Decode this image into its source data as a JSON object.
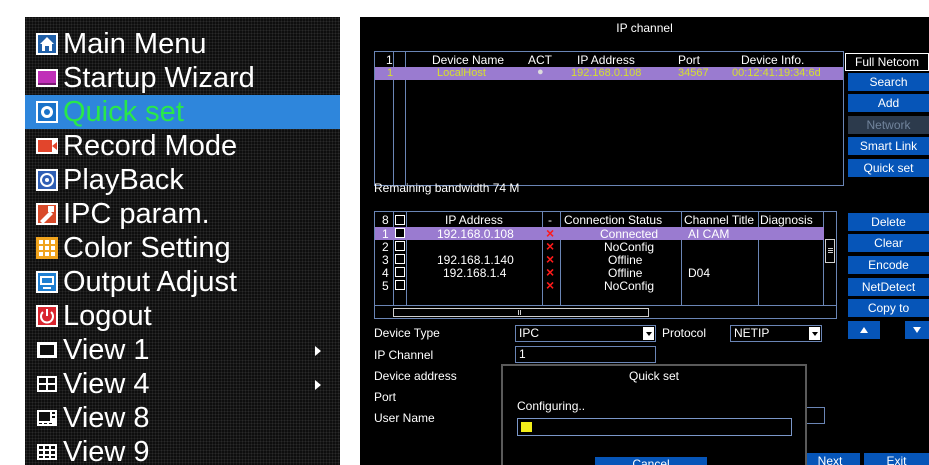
{
  "menu": {
    "items": [
      {
        "label": "Main Menu",
        "icon": "home-icon"
      },
      {
        "label": "Startup Wizard",
        "icon": "wizard-icon"
      },
      {
        "label": "Quick set",
        "icon": "quick-set-icon",
        "selected": true
      },
      {
        "label": "Record Mode",
        "icon": "record-icon"
      },
      {
        "label": "PlayBack",
        "icon": "playback-icon"
      },
      {
        "label": "IPC param.",
        "icon": "ipc-param-icon"
      },
      {
        "label": "Color Setting",
        "icon": "color-setting-icon"
      },
      {
        "label": "Output Adjust",
        "icon": "output-adjust-icon"
      },
      {
        "label": "Logout",
        "icon": "power-icon"
      },
      {
        "label": "View 1",
        "icon": "view-1-icon",
        "submenu": true
      },
      {
        "label": "View 4",
        "icon": "view-4-icon",
        "submenu": true
      },
      {
        "label": "View 8",
        "icon": "view-8-icon"
      },
      {
        "label": "View 9",
        "icon": "view-9-icon"
      }
    ],
    "highlight_color": "#2e86dc",
    "selected_text_color": "#29e84a"
  },
  "ip_channel": {
    "title": "IP channel",
    "device_table": {
      "headers": [
        "1",
        "Device Name",
        "ACT",
        "IP Address",
        "Port",
        "Device Info."
      ],
      "rows": [
        {
          "num": "1",
          "name": "LocalHost",
          "act": "●",
          "ip": "192.168.0.108",
          "port": "34567",
          "info": "00:12:41:19:34:6d"
        }
      ]
    },
    "remaining_bandwidth": "Remaining bandwidth  74 M",
    "side_buttons_top": [
      {
        "label": "Full Netcom",
        "style": "outline"
      },
      {
        "label": "Search",
        "style": "normal"
      },
      {
        "label": "Add",
        "style": "normal"
      },
      {
        "label": "Network",
        "style": "disabled"
      },
      {
        "label": "Smart Link",
        "style": "normal"
      },
      {
        "label": "Quick set",
        "style": "normal"
      }
    ],
    "channel_table": {
      "headers": [
        "8",
        "IP Address",
        "-",
        "Connection Status",
        "Channel Title",
        "Diagnosis"
      ],
      "rows": [
        {
          "num": "1",
          "ip": "192.168.0.108",
          "status": "Connected",
          "title": "AI CAM",
          "selected": true
        },
        {
          "num": "2",
          "ip": "",
          "status": "NoConfig",
          "title": ""
        },
        {
          "num": "3",
          "ip": "192.168.1.140",
          "status": "Offline",
          "title": ""
        },
        {
          "num": "4",
          "ip": "192.168.1.4",
          "status": "Offline",
          "title": "D04"
        },
        {
          "num": "5",
          "ip": "",
          "status": "NoConfig",
          "title": ""
        }
      ],
      "status_mark": "×"
    },
    "side_buttons_bottom": [
      {
        "label": "Delete"
      },
      {
        "label": "Clear"
      },
      {
        "label": "Encode"
      },
      {
        "label": "NetDetect"
      },
      {
        "label": "Copy to"
      }
    ],
    "form": {
      "device_type_label": "Device Type",
      "device_type_value": "IPC",
      "protocol_label": "Protocol",
      "protocol_value": "NETIP",
      "ip_channel_label": "IP Channel",
      "ip_channel_value": "1",
      "device_address_label": "Device address",
      "port_label": "Port",
      "user_name_label": "User Name"
    },
    "bottom_buttons": {
      "next": "Next",
      "exit": "Exit"
    },
    "colors": {
      "button_blue": "#0655b8",
      "selected_row": "#9a7bd0",
      "selected_row_text": "#d6e02c",
      "status_x": "#ff1a1a"
    }
  },
  "quick_set_dialog": {
    "title": "Quick set",
    "message": "Configuring..",
    "progress": 0.04,
    "cancel_label": "Cancel"
  }
}
